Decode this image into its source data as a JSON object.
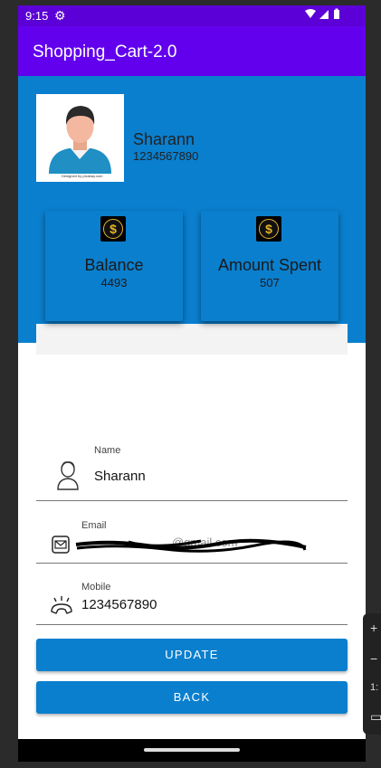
{
  "status": {
    "time": "9:15",
    "settings_icon": "gear-icon",
    "right_icons": "wifi-icon signal-icon battery-icon"
  },
  "app": {
    "title": "Shopping_Cart-2.0",
    "primary_color": "#6200ee",
    "accent_color": "#0a7fce"
  },
  "profile": {
    "name": "Sharann",
    "phone": "1234567890",
    "avatar_caption": "Designed by pixabay.com"
  },
  "cards": [
    {
      "label": "Balance",
      "value": "4493",
      "icon": "dollar-coin-icon"
    },
    {
      "label": "Amount Spent",
      "value": "507",
      "icon": "dollar-coin-icon"
    }
  ],
  "form": {
    "name": {
      "label": "Name",
      "value": "Sharann"
    },
    "email": {
      "label": "Email",
      "value": "@gmail.com"
    },
    "mobile": {
      "label": "Mobile",
      "value": "1234567890"
    }
  },
  "buttons": {
    "update": "UPDATE",
    "back": "BACK"
  },
  "side_panel": {
    "plus": "+",
    "minus": "−",
    "ratio": "1:"
  }
}
